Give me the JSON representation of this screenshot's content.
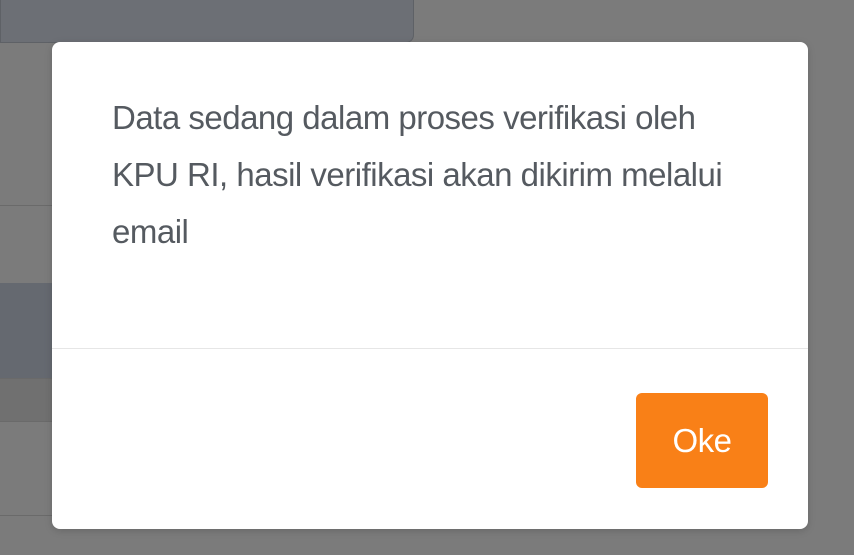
{
  "dialog": {
    "message": "Data sedang dalam proses verifikasi oleh KPU RI, hasil verifikasi akan dikirim melalui email",
    "confirm_label": "Oke"
  },
  "colors": {
    "overlay": "#7b7b7b",
    "dialog_background": "#ffffff",
    "message_text": "#555a60",
    "button_background": "#f98017",
    "button_text": "#ffffff"
  }
}
